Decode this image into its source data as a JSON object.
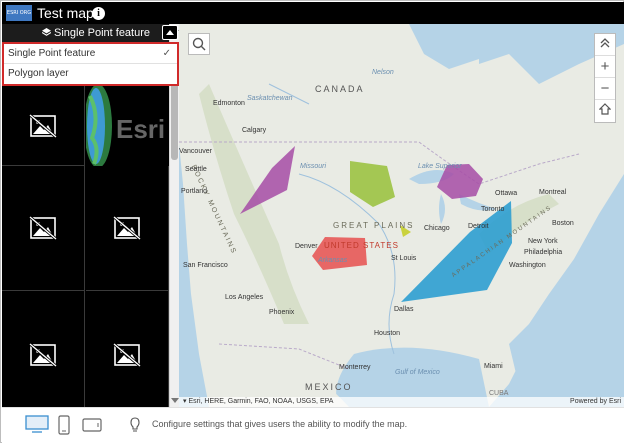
{
  "app": {
    "title": "Test map",
    "logo_text": "ESRI ORG"
  },
  "sidebar": {
    "header_title": "Single Point feature",
    "dropdown": {
      "items": [
        {
          "label": "Single Point feature",
          "selected": true
        },
        {
          "label": "Polygon layer",
          "selected": false
        }
      ]
    },
    "tiles": [
      "no-image-icon",
      "esri-globe-thumbnail",
      "no-image-icon",
      "no-image-icon",
      "no-image-icon",
      "no-image-icon"
    ]
  },
  "map": {
    "labels": {
      "canada": "CANADA",
      "mexico": "MEXICO",
      "rocky_mountains": "ROCKY MOUNTAINS",
      "great_plains": "GREAT PLAINS",
      "united_states": "UNITED STATES",
      "appalachian": "APPALACHIAN MOUNTAINS",
      "edmonton": "Edmonton",
      "calgary": "Calgary",
      "vancouver": "Vancouver",
      "seattle": "Seattle",
      "portland": "Portland",
      "san_francisco": "San Francisco",
      "los_angeles": "Los Angeles",
      "phoenix": "Phoenix",
      "denver": "Denver",
      "dallas": "Dallas",
      "houston": "Houston",
      "monterrey": "Monterrey",
      "st_louis": "St Louis",
      "chicago": "Chicago",
      "detroit": "Detroit",
      "toronto": "Toronto",
      "ottawa": "Ottawa",
      "montreal": "Montreal",
      "boston": "Boston",
      "new_york": "New York",
      "philadelphia": "Philadelphia",
      "washington": "Washington",
      "miami": "Miami",
      "gulf_of_mexico": "Gulf of Mexico",
      "lake_superior": "Lake Superior",
      "missouri": "Missouri",
      "arkansas": "Arkansas",
      "saskatchewan": "Saskatchewan",
      "nelson": "Nelson",
      "cuba": "CUBA"
    },
    "polygons": [
      {
        "name": "purple-west",
        "color": "#a64ca6"
      },
      {
        "name": "green-north-central",
        "color": "#98c13a"
      },
      {
        "name": "purple-great-lakes",
        "color": "#a64ca6"
      },
      {
        "name": "red-central",
        "color": "#e6504f"
      },
      {
        "name": "blue-east",
        "color": "#2d9fd0"
      },
      {
        "name": "yellow-small",
        "color": "#c7cf2a"
      }
    ],
    "attribution": "Esri, HERE, Garmin, FAO, NOAA, USGS, EPA",
    "powered_by": "Powered by Esri"
  },
  "footer": {
    "text": "Configure settings that gives users the ability to modify the map.",
    "devices": [
      "desktop-icon",
      "phone-icon",
      "tablet-icon"
    ]
  }
}
